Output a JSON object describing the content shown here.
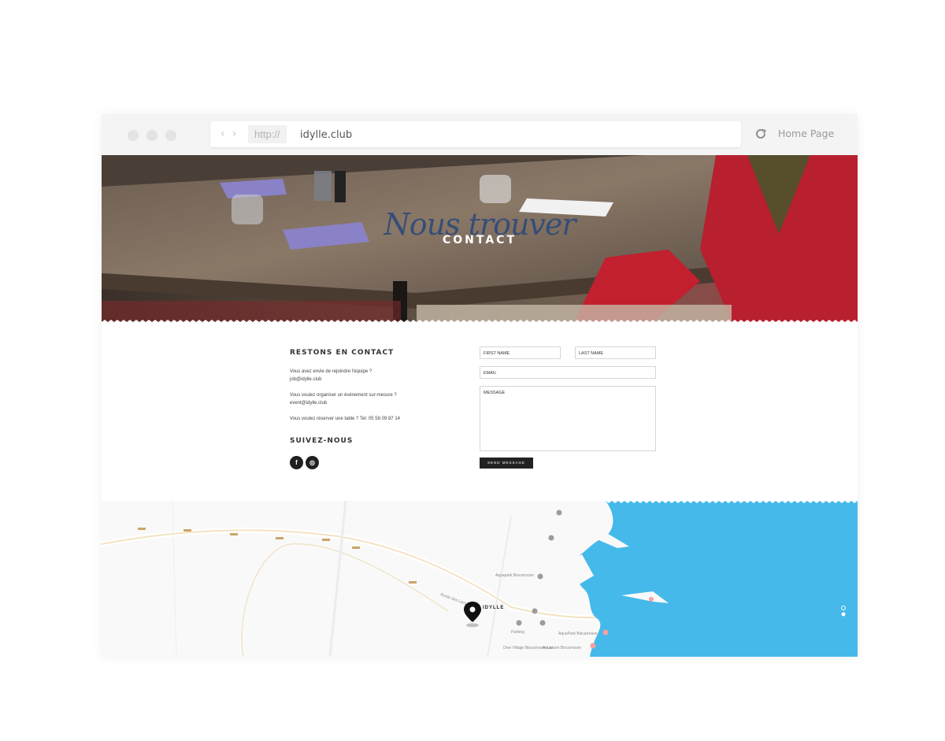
{
  "browser": {
    "protocol": "http://",
    "url": "idylle.club",
    "home_label": "Home Page"
  },
  "hero": {
    "script_title": "Nous trouver",
    "title": "CONTACT"
  },
  "contact": {
    "heading": "RESTONS EN CONTACT",
    "lines": [
      "Vous avez envie de rejoindre l'équipe ?",
      "job@idylle.club",
      "Vous voulez organiser un événement sur-mesure ?",
      "event@idylle.club",
      "Vous voulez réserver une table ? Tel: 05 58 09 87 14"
    ],
    "follow_heading": "SUIVEZ-NOUS",
    "social": [
      {
        "name": "facebook-icon",
        "glyph": "f"
      },
      {
        "name": "instagram-icon",
        "glyph": "◎"
      }
    ]
  },
  "form": {
    "first_name": "FIRST NAME",
    "last_name": "LAST NAME",
    "email": "EMAIL",
    "message": "MESSAGE",
    "send": "SEND MESSAGE"
  },
  "map": {
    "marker_label": "IDYLLE",
    "places": [
      "Aquapark Biscarrosse",
      "AquaPark Biscarrosse",
      "Parking",
      "Aquarium Biscarrosse",
      "Dive Village Biscarrosse Lac"
    ],
    "road_label": "Route des Lacs",
    "colors": {
      "water": "#45b9ea",
      "land": "#f9f9f9",
      "road": "#f3e3c3"
    }
  }
}
